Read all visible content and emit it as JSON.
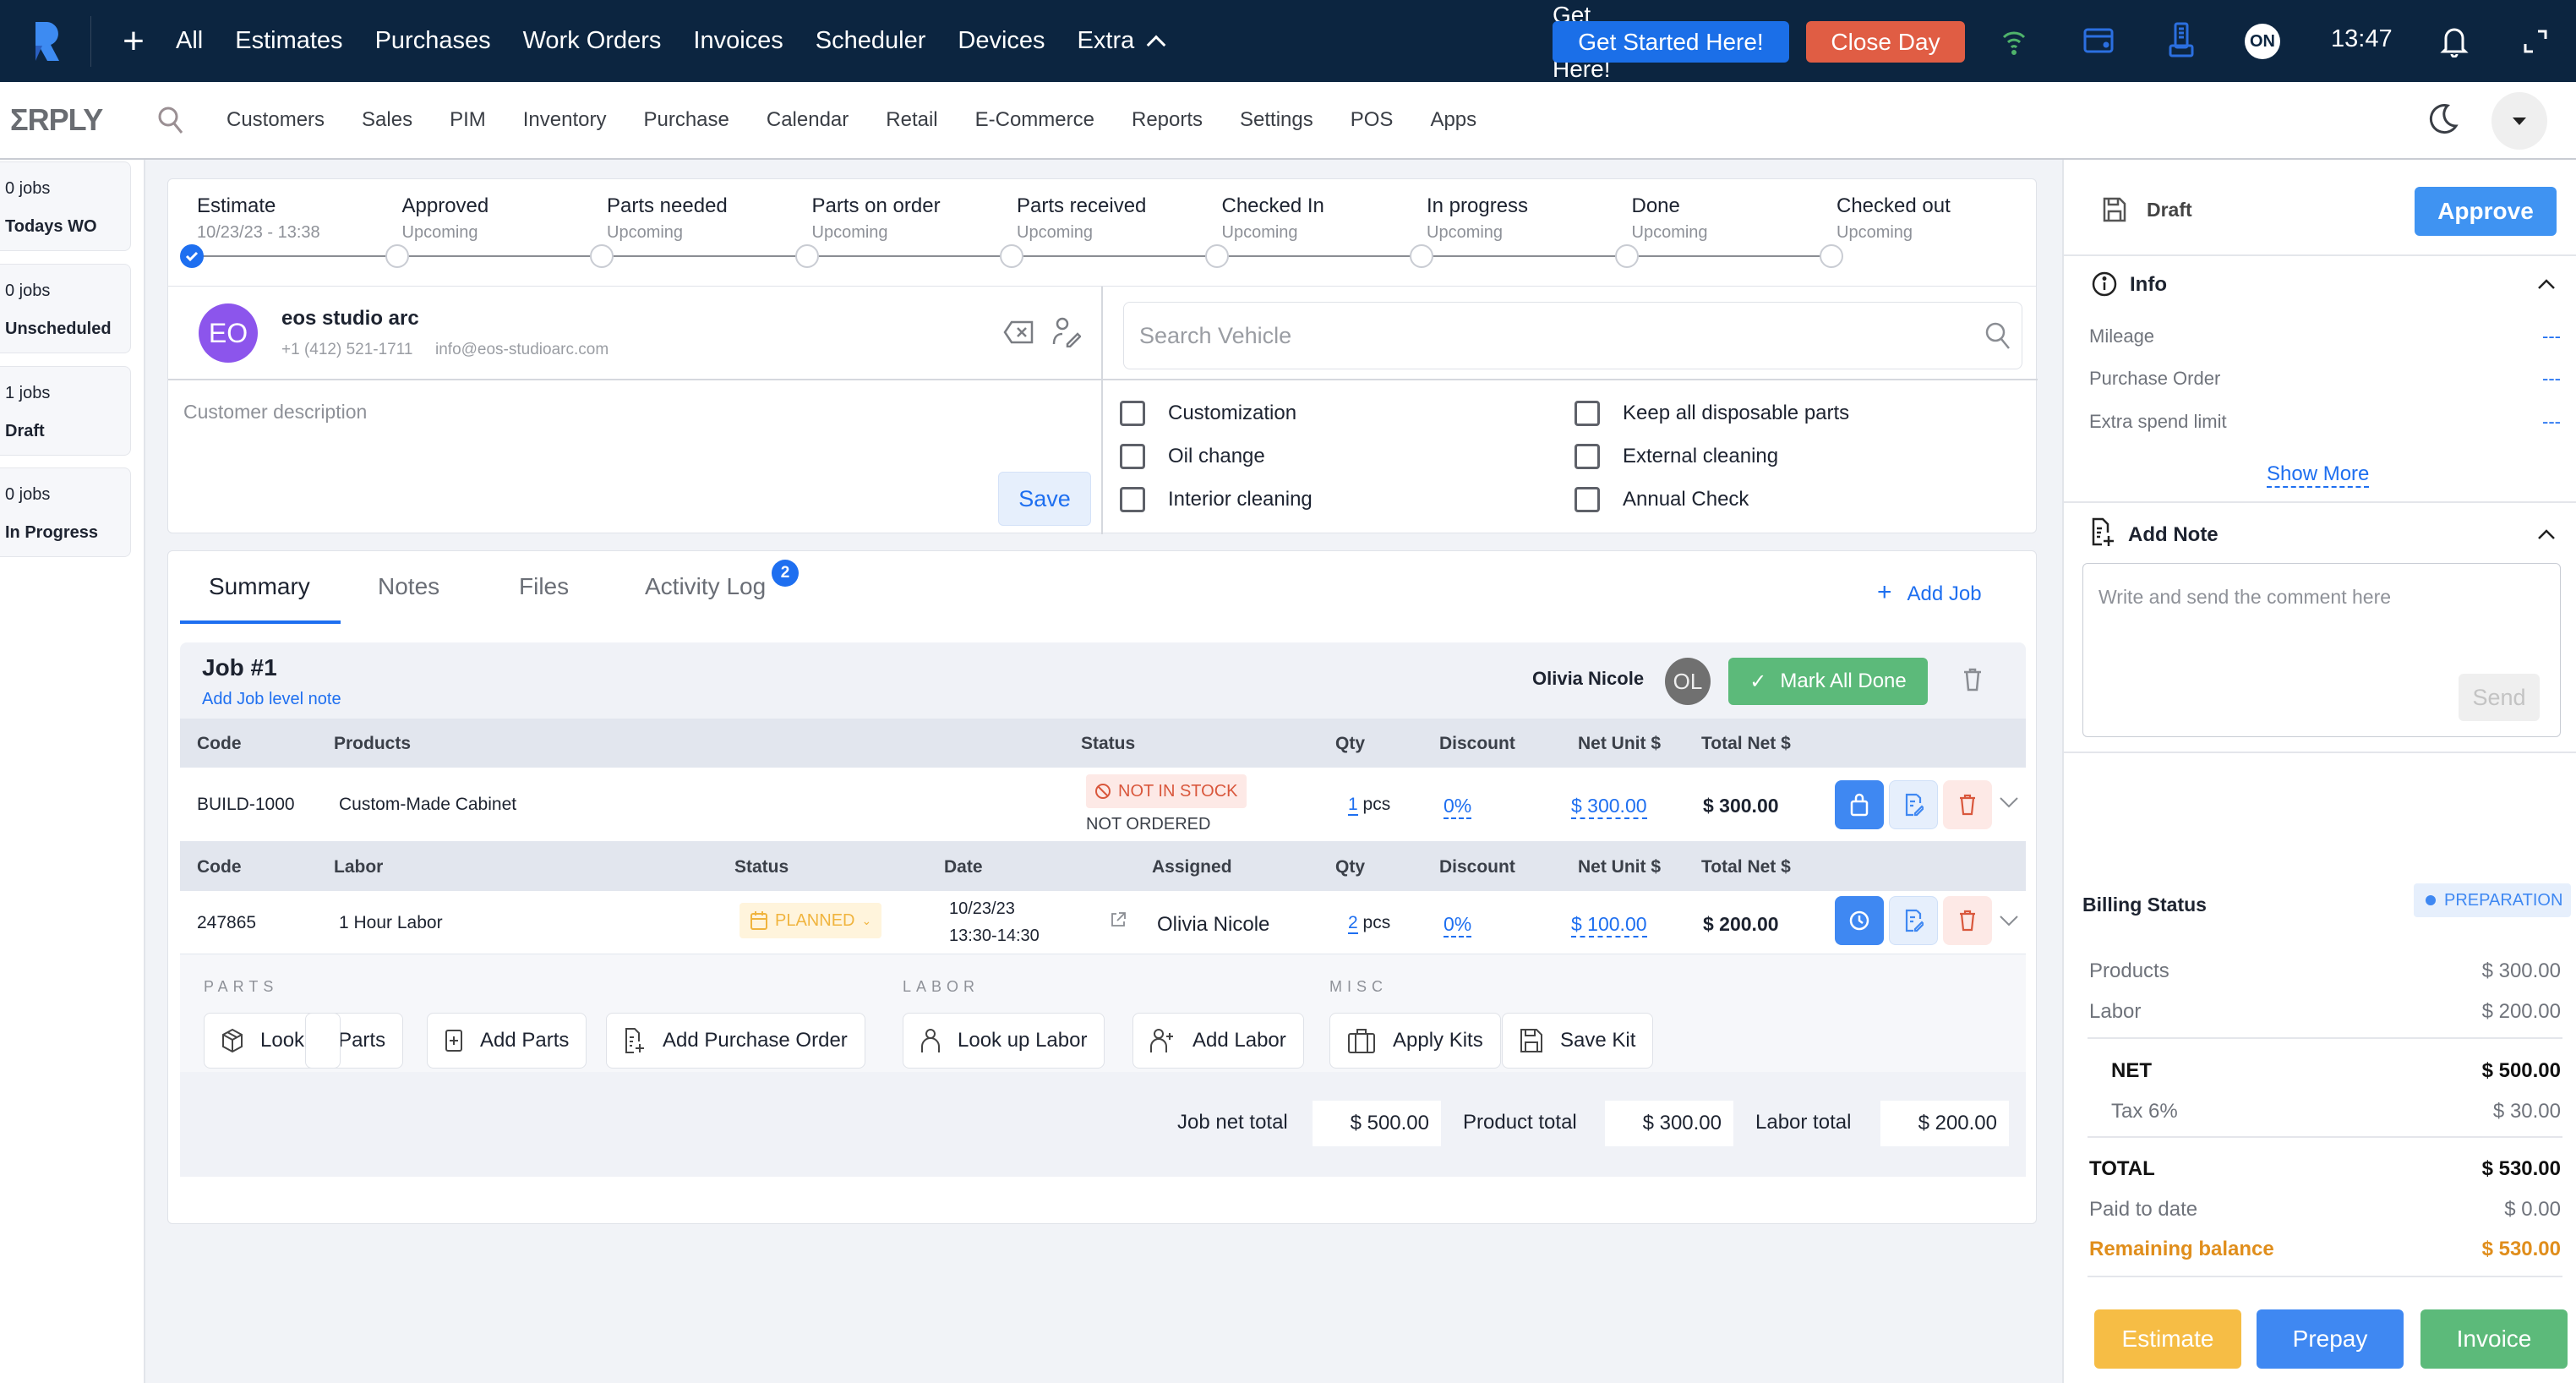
{
  "topbar": {
    "nav": [
      "All",
      "Estimates",
      "Purchases",
      "Work Orders",
      "Invoices",
      "Scheduler",
      "Devices",
      "Extra"
    ],
    "get_started": "Get Started Here!",
    "close_day": "Close Day",
    "user_initials": "ON",
    "time": "13:47",
    "colors": {
      "bg": "#0c2540",
      "get_started": "#1b6fe8",
      "close_day": "#e05d44"
    }
  },
  "nav2": {
    "brand": "ΣRPLY",
    "items": [
      "Customers",
      "Sales",
      "PIM",
      "Inventory",
      "Purchase",
      "Calendar",
      "Retail",
      "E-Commerce",
      "Reports",
      "Settings",
      "POS",
      "Apps"
    ]
  },
  "sidebar": [
    {
      "count": "0 jobs",
      "label": "Todays WO"
    },
    {
      "count": "0 jobs",
      "label": "Unscheduled"
    },
    {
      "count": "1 jobs",
      "label": "Draft"
    },
    {
      "count": "0 jobs",
      "label": "In Progress"
    }
  ],
  "steps": [
    {
      "name": "Estimate",
      "sub": "10/23/23 - 13:38",
      "done": true
    },
    {
      "name": "Approved",
      "sub": "Upcoming",
      "done": false
    },
    {
      "name": "Parts needed",
      "sub": "Upcoming",
      "done": false
    },
    {
      "name": "Parts on order",
      "sub": "Upcoming",
      "done": false
    },
    {
      "name": "Parts received",
      "sub": "Upcoming",
      "done": false
    },
    {
      "name": "Checked In",
      "sub": "Upcoming",
      "done": false
    },
    {
      "name": "In progress",
      "sub": "Upcoming",
      "done": false
    },
    {
      "name": "Done",
      "sub": "Upcoming",
      "done": false
    },
    {
      "name": "Checked out",
      "sub": "Upcoming",
      "done": false
    }
  ],
  "customer": {
    "initials": "EO",
    "name": "eos studio arc",
    "phone": "+1 (412) 521-1711",
    "email": "info@eos-studioarc.com",
    "description_placeholder": "Customer description",
    "save": "Save"
  },
  "vehicle": {
    "search_placeholder": "Search Vehicle",
    "checkboxes": [
      {
        "label": "Customization",
        "checked": false
      },
      {
        "label": "Oil change",
        "checked": false
      },
      {
        "label": "Interior cleaning",
        "checked": false
      },
      {
        "label": "Keep all disposable parts",
        "checked": false
      },
      {
        "label": "External cleaning",
        "checked": false
      },
      {
        "label": "Annual Check",
        "checked": false
      }
    ]
  },
  "tabs": {
    "items": [
      "Summary",
      "Notes",
      "Files",
      "Activity Log"
    ],
    "active": "Summary",
    "activity_badge": "2",
    "add_job": "Add Job"
  },
  "job": {
    "title": "Job #1",
    "note_link": "Add Job level note",
    "assignee": "Olivia Nicole",
    "assignee_initials": "OL",
    "mark_all_done": "Mark All Done",
    "products_header": [
      "Code",
      "Products",
      "Status",
      "Qty",
      "Discount",
      "Net Unit $",
      "Total Net $"
    ],
    "products": [
      {
        "code": "BUILD-1000",
        "name": "Custom-Made Cabinet",
        "status": "NOT IN STOCK",
        "substatus": "NOT ORDERED",
        "qty": "1",
        "unit": "pcs",
        "discount": "0%",
        "net_unit": "$ 300.00",
        "total_net": "$ 300.00"
      }
    ],
    "labor_header": [
      "Code",
      "Labor",
      "Status",
      "Date",
      "Assigned",
      "Qty",
      "Discount",
      "Net Unit $",
      "Total Net $"
    ],
    "labor": [
      {
        "code": "247865",
        "name": "1 Hour Labor",
        "status": "PLANNED",
        "date": "10/23/23",
        "time": "13:30-14:30",
        "assigned": "Olivia Nicole",
        "qty": "2",
        "unit": "pcs",
        "discount": "0%",
        "net_unit": "$ 100.00",
        "total_net": "$ 200.00"
      }
    ],
    "sections": {
      "parts": "PARTS",
      "labor": "LABOR",
      "misc": "MISC"
    },
    "actions": {
      "lookup_parts": "Look up Parts",
      "add_parts": "Add Parts",
      "add_po": "Add Purchase Order",
      "lookup_labor": "Look up Labor",
      "add_labor": "Add Labor",
      "apply_kits": "Apply Kits",
      "save_kit": "Save Kit"
    },
    "totals": {
      "job_net_label": "Job net total",
      "job_net": "$ 500.00",
      "product_label": "Product total",
      "product": "$ 300.00",
      "labor_label": "Labor total",
      "labor": "$ 200.00"
    }
  },
  "right": {
    "status": "Draft",
    "approve": "Approve",
    "info_title": "Info",
    "info": [
      {
        "label": "Mileage",
        "value": "---"
      },
      {
        "label": "Purchase Order",
        "value": "---"
      },
      {
        "label": "Extra spend limit",
        "value": "---"
      }
    ],
    "show_more": "Show More",
    "note_title": "Add Note",
    "note_placeholder": "Write and send the comment here",
    "send": "Send",
    "billing_title": "Billing Status",
    "billing_status": "PREPARATION",
    "billing": {
      "products_label": "Products",
      "products": "$ 300.00",
      "labor_label": "Labor",
      "labor": "$ 200.00",
      "net_label": "NET",
      "net": "$ 500.00",
      "tax_label": "Tax 6%",
      "tax": "$ 30.00",
      "total_label": "TOTAL",
      "total": "$ 530.00",
      "paid_label": "Paid to date",
      "paid": "$ 0.00",
      "remaining_label": "Remaining balance",
      "remaining": "$ 530.00"
    },
    "buttons": {
      "estimate": "Estimate",
      "prepay": "Prepay",
      "invoice": "Invoice"
    },
    "colors": {
      "estimate": "#f6bd45",
      "prepay": "#3f88f2",
      "invoice": "#5cba7a",
      "remaining": "#e08e1c"
    }
  }
}
